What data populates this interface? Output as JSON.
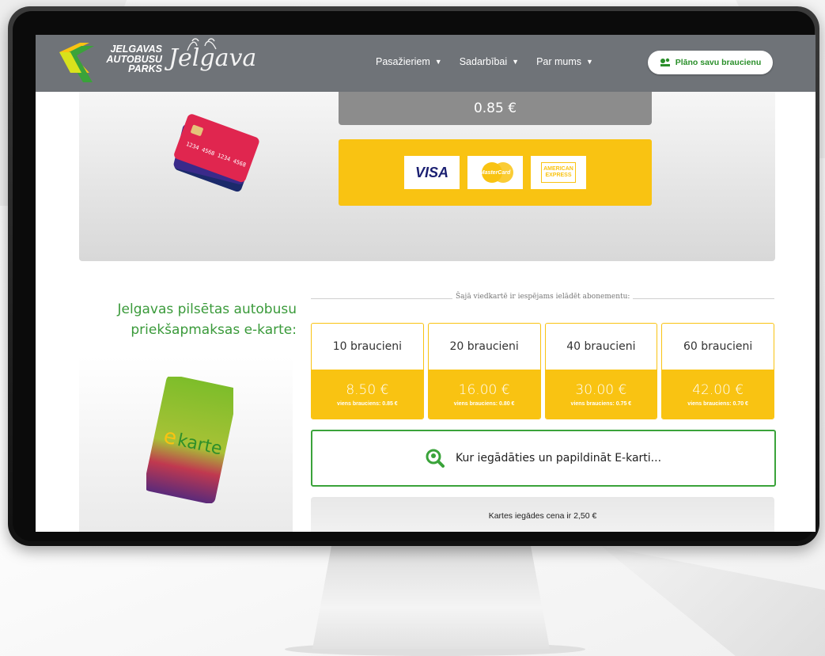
{
  "header": {
    "logo_lines": [
      "JELGAVAS",
      "AUTOBUSU",
      "PARKS"
    ],
    "city_logo_text": "Jelgava",
    "nav": [
      {
        "label": "Pasažieriem"
      },
      {
        "label": "Sadarbībai"
      },
      {
        "label": "Par mums"
      }
    ],
    "cta_label": "Plāno savu braucienu"
  },
  "payment": {
    "card_price": "0.85 €",
    "brands": {
      "visa": "VISA",
      "mastercard": "MasterCard",
      "amex_line1": "AMERICAN",
      "amex_line2": "EXPRESS"
    }
  },
  "ekarte": {
    "title_line1": "Jelgavas pilsētas autobusu",
    "title_line2": "priekšapmaksas e-karte:",
    "divider_text": "Šajā viedkartē ir iespējams ielādēt abonementu:",
    "card_label": "ekarte",
    "plans": [
      {
        "name": "10 braucieni",
        "price": "8.50 €",
        "per_ride": "viens brauciens: 0.85 €"
      },
      {
        "name": "20 braucieni",
        "price": "16.00 €",
        "per_ride": "viens brauciens: 0.80 €"
      },
      {
        "name": "40 braucieni",
        "price": "30.00 €",
        "per_ride": "viens brauciens: 0.75 €"
      },
      {
        "name": "60 braucieni",
        "price": "42.00 €",
        "per_ride": "viens brauciens: 0.70 €"
      }
    ],
    "where_label": "Kur iegādāties un papildināt E-karti...",
    "card_price_note": "Kartes iegādes cena ir 2,50 €"
  },
  "colors": {
    "accent_yellow": "#f9c312",
    "accent_green": "#3aa33a",
    "header_gray": "#6f7378"
  },
  "icons": [
    "caret-down-icon",
    "route-icon",
    "search-location-icon"
  ]
}
